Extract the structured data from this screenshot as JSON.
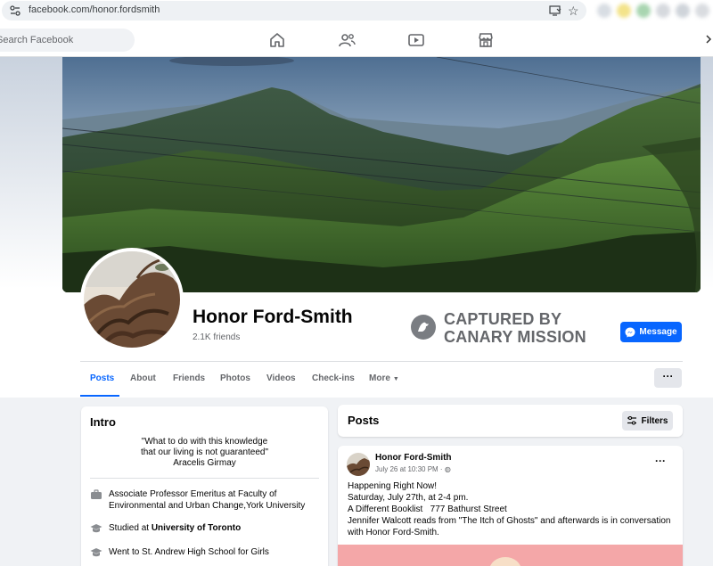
{
  "browser": {
    "url": "facebook.com/honor.fordsmith"
  },
  "nav": {
    "search_placeholder": "Search Facebook",
    "icons": [
      "home-icon",
      "friends-icon",
      "video-icon",
      "marketplace-icon"
    ]
  },
  "profile": {
    "name": "Honor Ford-Smith",
    "friends": "2.1K friends",
    "message_label": "Message"
  },
  "stamp": {
    "line1": "CAPTURED BY",
    "line2": "CANARY MISSION",
    "color": "#65676b"
  },
  "tabs": {
    "items": [
      "Posts",
      "About",
      "Friends",
      "Photos",
      "Videos",
      "Check-ins",
      "More"
    ],
    "active": "Posts",
    "more_menu": "···"
  },
  "intro": {
    "title": "Intro",
    "quote_line1": "\"What to do with this knowledge",
    "quote_line2": "that our living is not guaranteed\"",
    "quote_author": "Aracelis Girmay",
    "work": "Associate Professor Emeritus at Faculty of Environmental and Urban Change,York University",
    "studied_prefix": "Studied at",
    "studied_school": "University of Toronto",
    "highschool": "Went to St. Andrew High School for Girls"
  },
  "posts": {
    "title": "Posts",
    "filters_label": "Filters"
  },
  "post": {
    "author": "Honor Ford-Smith",
    "time": "July 26 at 10:30 PM ·",
    "options": "···",
    "lines": [
      "Happening Right Now!",
      "Saturday, July 27th, at 2-4 pm.",
      "A Different Booklist   777 Bathurst Street",
      "Jennifer Walcott reads from \"The Itch of Ghosts\" and afterwards is in conversation with Honor Ford-Smith."
    ]
  },
  "colors": {
    "accent": "#0866ff",
    "background": "#f0f2f5",
    "secondary_text": "#65676b"
  }
}
